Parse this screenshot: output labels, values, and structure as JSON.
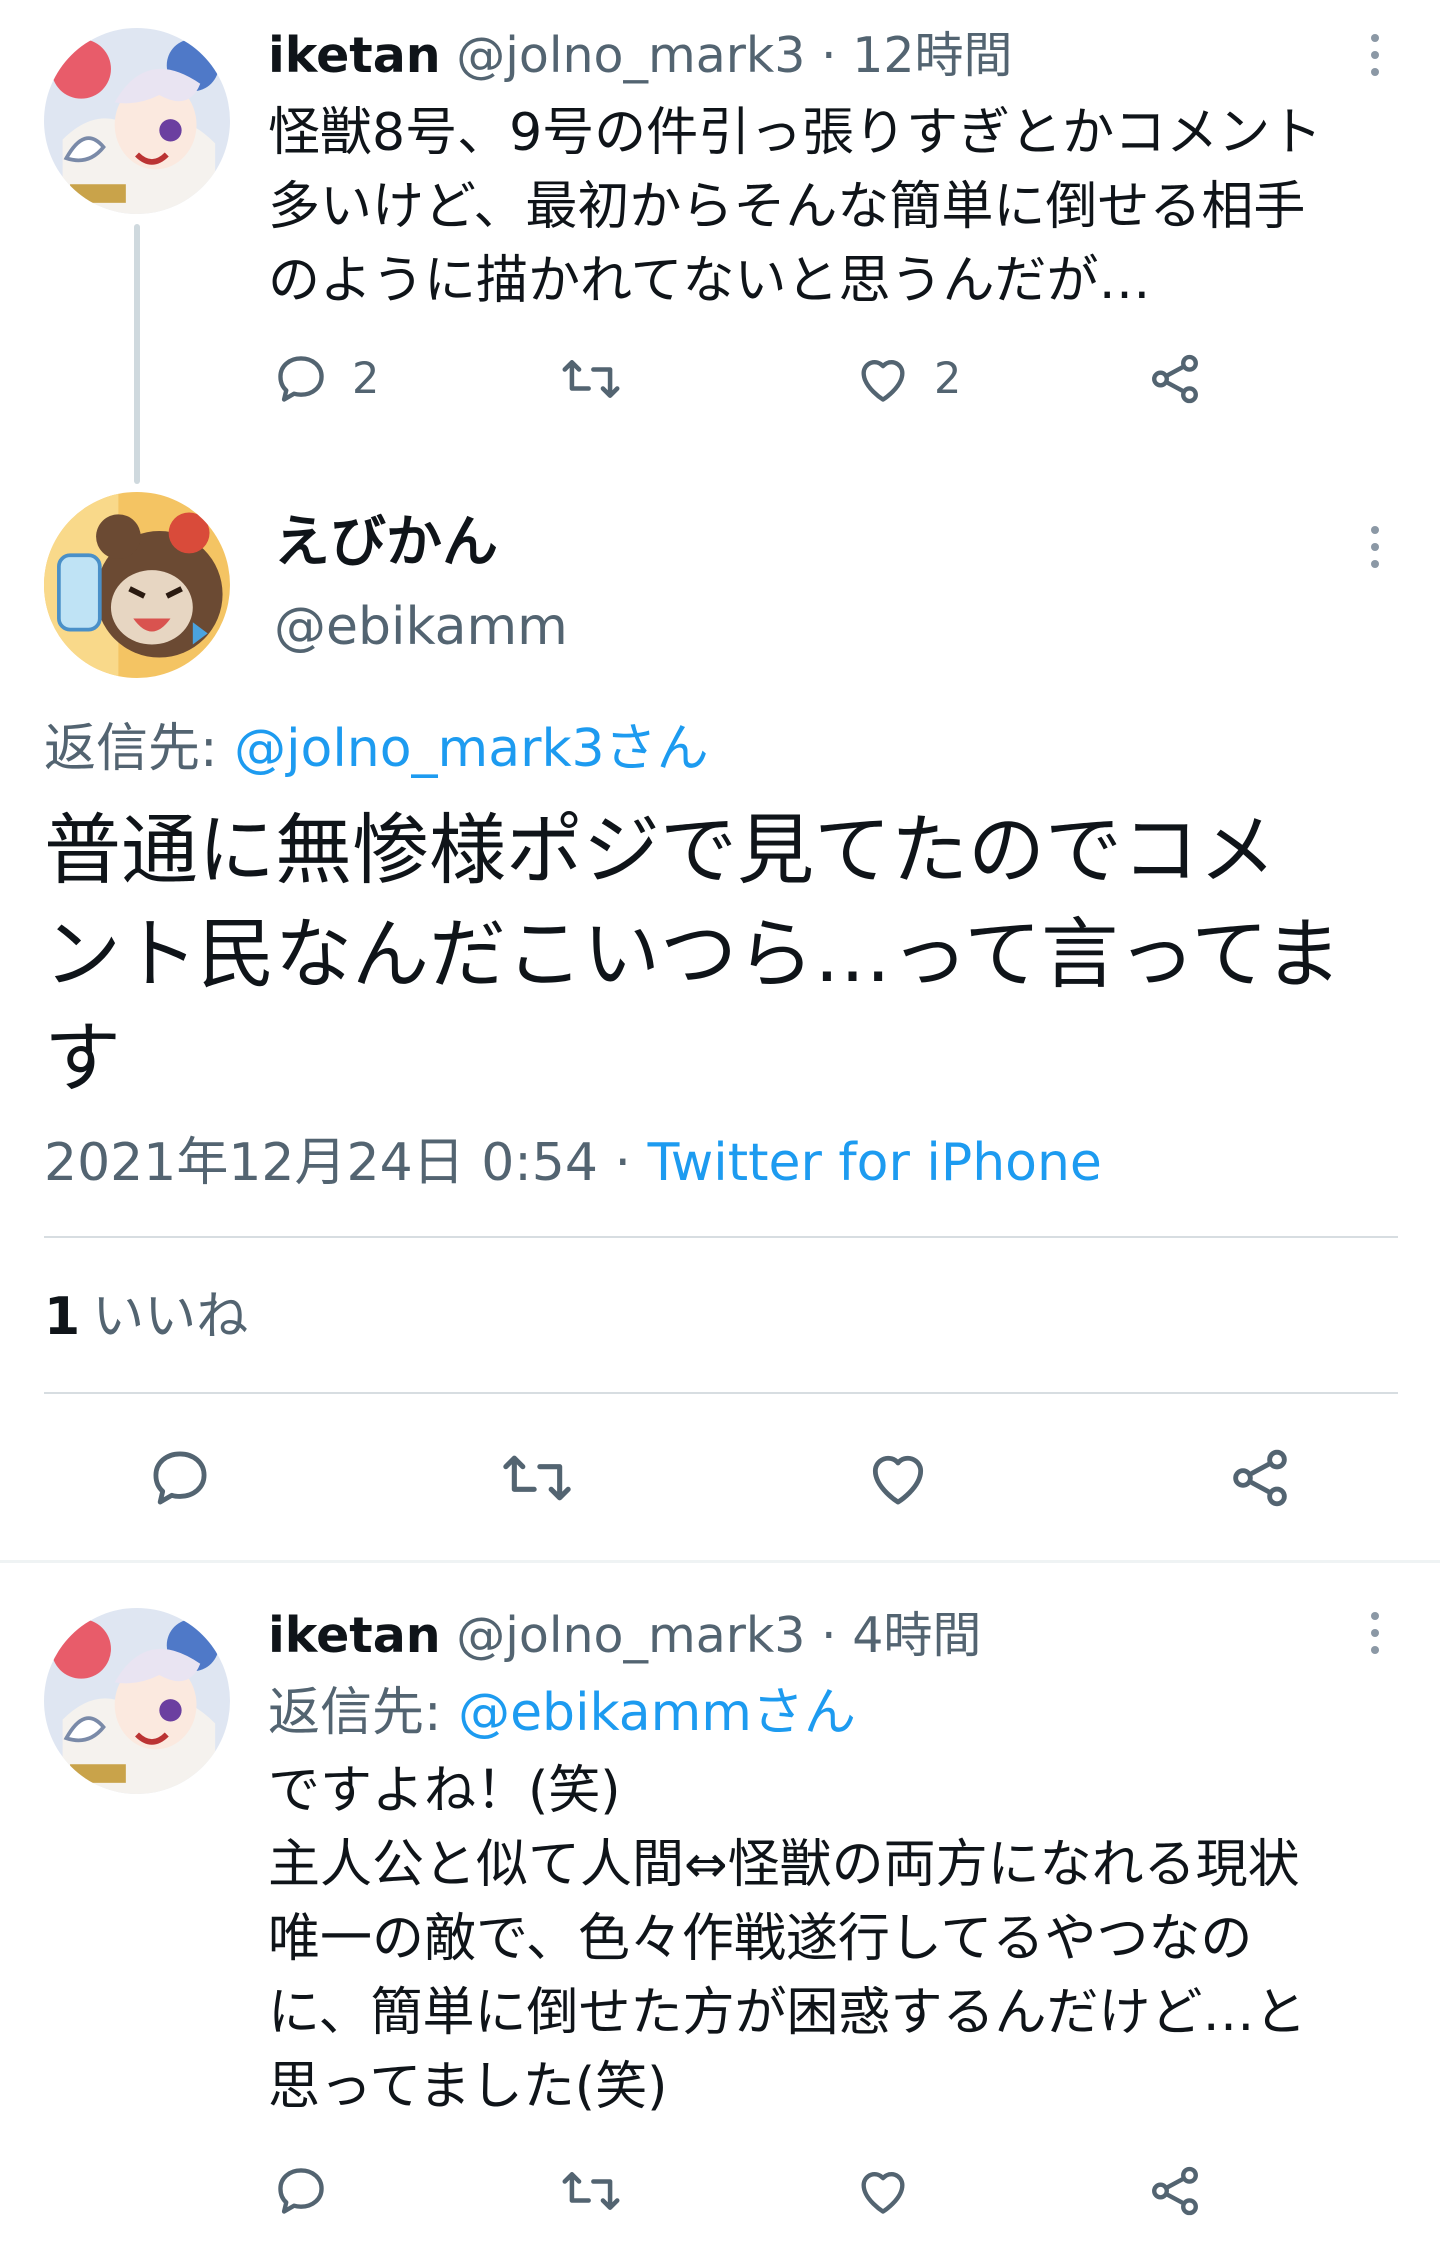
{
  "colors": {
    "link": "#1d9bf0",
    "muted": "#536471",
    "text": "#0f1419"
  },
  "tweet1": {
    "name": "iketan",
    "handle": "@jolno_mark3",
    "time": "· 12時間",
    "lines": [
      "怪獣8号、9号の件引っ張りすぎとかコメント",
      "多いけど、最初からそんな簡単に倒せる相手",
      "のように描かれてないと思うんだが…"
    ],
    "reply_count": "2",
    "like_count": "2"
  },
  "main": {
    "name": "えびかん",
    "handle": "@ebikamm",
    "reply_prefix": "返信先: ",
    "reply_target": "@jolno_mark3さん",
    "lines": [
      "普通に無惨様ポジで見てたのでコメ",
      "ント民なんだこいつら…って言ってま",
      "す"
    ],
    "timestamp": "2021年12月24日 0:54 · ",
    "source": "Twitter for iPhone",
    "likes_num": "1",
    "likes_label": "いいね"
  },
  "tweet2": {
    "name": "iketan",
    "handle": "@jolno_mark3",
    "time": "· 4時間",
    "reply_prefix": "返信先: ",
    "reply_target": "@ebikammさん",
    "lines": [
      "ですよね！(笑)",
      "主人公と似て人間⇔怪獣の両方になれる現状",
      "唯一の敵で、色々作戦遂行してるやつなの",
      "に、簡単に倒せた方が困惑するんだけど…と",
      "思ってました(笑)"
    ]
  },
  "icons": [
    "reply-icon",
    "retweet-icon",
    "like-icon",
    "share-icon",
    "more-icon"
  ]
}
